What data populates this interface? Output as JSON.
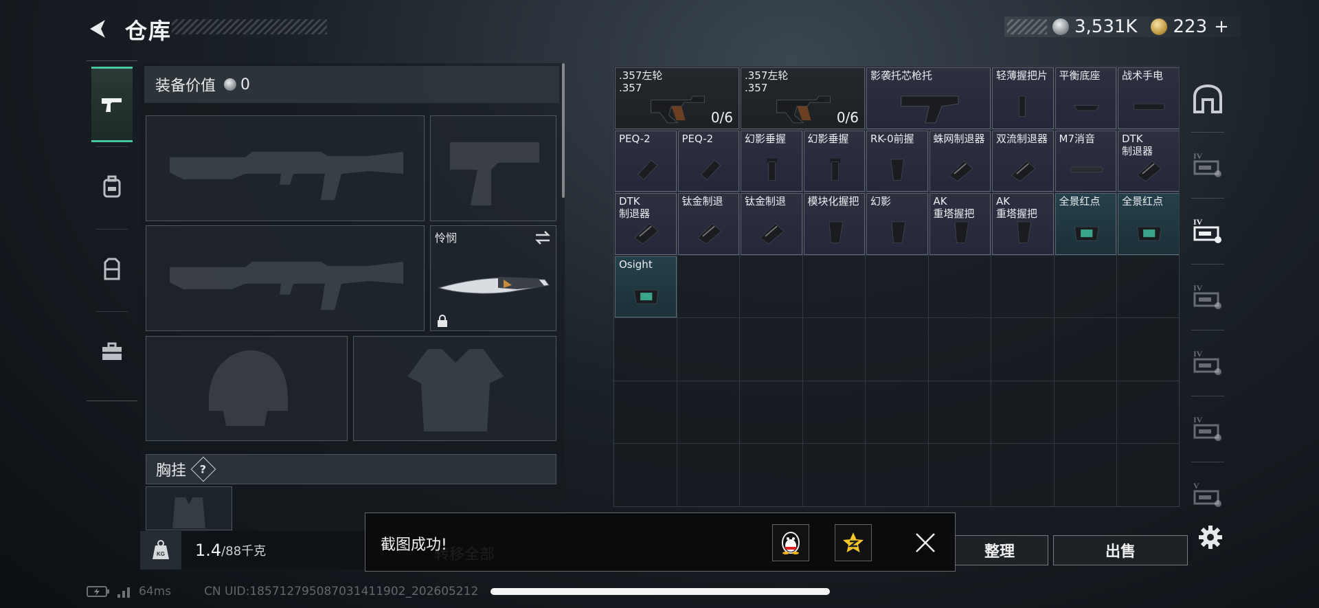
{
  "header": {
    "title": "仓库",
    "currency_silver": "3,531K",
    "currency_gold": "223",
    "add_symbol": "+"
  },
  "left_tabs": [
    {
      "name": "weapons",
      "icon": "pistol-icon",
      "active": true
    },
    {
      "name": "armor",
      "icon": "backpack-icon",
      "active": false
    },
    {
      "name": "bags",
      "icon": "rig-icon",
      "active": false
    },
    {
      "name": "kits",
      "icon": "briefcase-icon",
      "active": false
    }
  ],
  "equip": {
    "value_label": "装备价值",
    "value": "0",
    "knife_name": "怜悯",
    "chest_label": "胸挂",
    "help": "?",
    "weight_current": "1.4",
    "weight_max": "/88千克",
    "weight_icon_label": "KG"
  },
  "inventory": {
    "items": [
      {
        "name": ".357左轮\n.357",
        "count": "0/6",
        "style": "dark"
      },
      {
        "name": ".357左轮\n.357",
        "count": "0/6",
        "style": "dark"
      },
      {
        "name": "影袭托芯枪托",
        "count": "",
        "style": "purple"
      },
      {
        "name": "轻薄握把片",
        "count": "",
        "style": "purple"
      },
      {
        "name": "平衡底座",
        "count": "",
        "style": "purple"
      },
      {
        "name": "战术手电",
        "count": "",
        "style": "purple"
      },
      {
        "name": "PEQ-2",
        "count": "",
        "style": "purple"
      },
      {
        "name": "PEQ-2",
        "count": "",
        "style": "purple"
      },
      {
        "name": "幻影垂握",
        "count": "",
        "style": "purple"
      },
      {
        "name": "幻影垂握",
        "count": "",
        "style": "purple"
      },
      {
        "name": "RK-0前握",
        "count": "",
        "style": "purple"
      },
      {
        "name": "蛛网制退器",
        "count": "",
        "style": "purple"
      },
      {
        "name": "双流制退器",
        "count": "",
        "style": "purple"
      },
      {
        "name": "M7消音",
        "count": "",
        "style": "purple"
      },
      {
        "name": "DTK\n制退器",
        "count": "",
        "style": "purple"
      },
      {
        "name": "DTK\n制退器",
        "count": "",
        "style": "purple"
      },
      {
        "name": "钛金制退",
        "count": "",
        "style": "purple"
      },
      {
        "name": "钛金制退",
        "count": "",
        "style": "purple"
      },
      {
        "name": "模块化握把",
        "count": "",
        "style": "purple"
      },
      {
        "name": "幻影",
        "count": "",
        "style": "purple"
      },
      {
        "name": "AK\n重塔握把",
        "count": "",
        "style": "purple"
      },
      {
        "name": "AK\n重塔握把",
        "count": "",
        "style": "purple"
      },
      {
        "name": "全景红点",
        "count": "",
        "style": "green"
      },
      {
        "name": "全景红点",
        "count": "",
        "style": "green"
      },
      {
        "name": "Osight",
        "count": "",
        "style": "green"
      }
    ]
  },
  "right_tabs": [
    {
      "icon": "vault-icon",
      "level": ""
    },
    {
      "icon": "weapon-case-icon",
      "level": "IV"
    },
    {
      "icon": "weapon-rack-icon",
      "level": "IV"
    },
    {
      "icon": "gun-case-icon",
      "level": "IV"
    },
    {
      "icon": "storage-box-icon",
      "level": "IV"
    },
    {
      "icon": "medical-box-icon",
      "level": "IV"
    },
    {
      "icon": "ammo-box-icon",
      "level": "V"
    }
  ],
  "actions": {
    "sort": "整理",
    "sell": "出售",
    "transfer_all": "转移全部"
  },
  "toast": {
    "message": "截图成功!"
  },
  "status": {
    "ping": "64ms",
    "uid": "CN UID:1857127950870314119​02_202605212"
  }
}
